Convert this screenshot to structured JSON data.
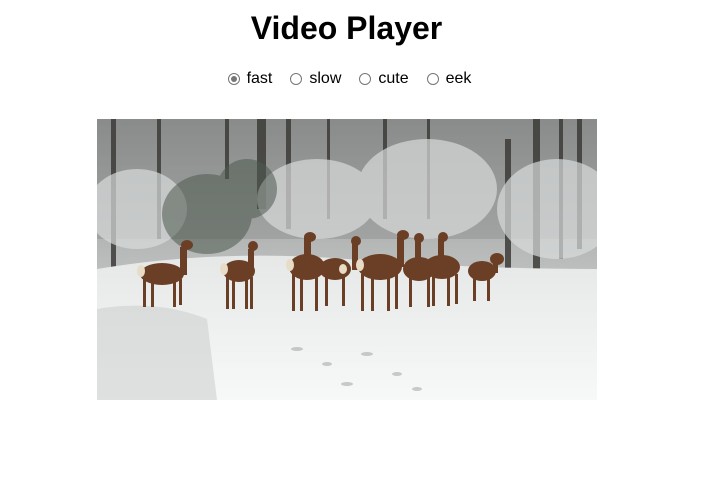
{
  "page": {
    "title": "Video Player"
  },
  "speed_options": [
    {
      "label": "fast",
      "checked": true
    },
    {
      "label": "slow",
      "checked": false
    },
    {
      "label": "cute",
      "checked": false
    },
    {
      "label": "eek",
      "checked": false
    }
  ],
  "video": {
    "scene": "deer in snowy forest"
  }
}
